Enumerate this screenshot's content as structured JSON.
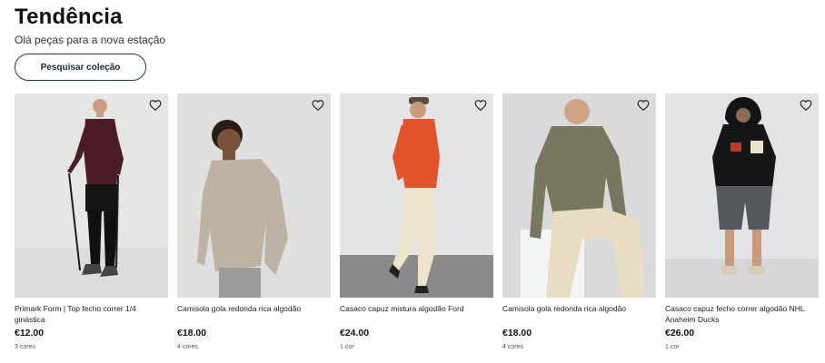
{
  "header": {
    "title": "Tendência",
    "subtitle": "Olá peças para a nova estação",
    "cta_label": "Pesquisar coleção"
  },
  "products": [
    {
      "name": "Primark Form | Top fecho correr 1/4 ginástica",
      "price": "€12.00",
      "colors": "3 cores",
      "icon": "heart-icon"
    },
    {
      "name": "Camisola gola redonda rica algodão",
      "price": "€18.00",
      "colors": "4 cores",
      "icon": "heart-icon"
    },
    {
      "name": "Casaco capuz mistura algodão Ford",
      "price": "€24.00",
      "colors": "1 cor",
      "icon": "heart-icon"
    },
    {
      "name": "Camisola gola redonda rica algodão",
      "price": "€18.00",
      "colors": "4 cores",
      "icon": "heart-icon"
    },
    {
      "name": "Casaco capuz fecho correr algodão NHL Anaheim Ducks",
      "price": "€26.00",
      "colors": "1 cor",
      "icon": "heart-icon"
    }
  ]
}
